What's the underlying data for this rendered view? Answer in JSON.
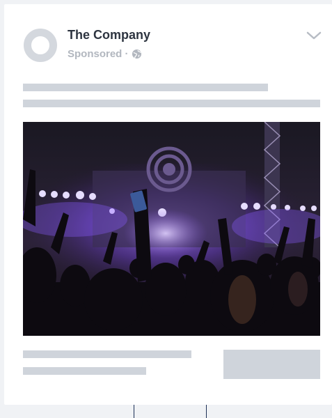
{
  "post": {
    "page_name": "The Company",
    "sponsored_label": "Sponsored · "
  },
  "icons": {
    "avatar": "avatar-placeholder",
    "privacy": "globe-icon",
    "menu": "chevron-down-icon"
  },
  "image": {
    "subject": "concert-crowd-photo"
  },
  "colors": {
    "placeholder": "#cfd4db",
    "title": "#2d3440",
    "subtitle": "#b2b7bf",
    "stage_light": "#8a5cff"
  }
}
